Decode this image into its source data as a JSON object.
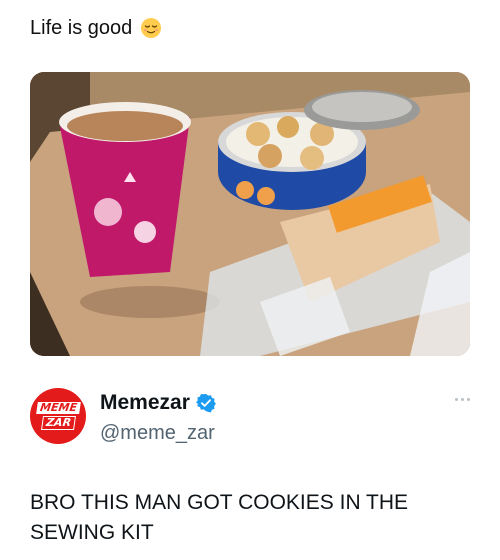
{
  "caption": {
    "text": "Life is good",
    "emoji": "relieved-face-emoji"
  },
  "photo": {
    "alt_subject": "photo"
  },
  "author": {
    "name": "Memezar",
    "handle": "@meme_zar",
    "verified": true,
    "avatar": {
      "line1": "MEME",
      "line2": "ZAR",
      "color": "#e31b1b"
    }
  },
  "post": {
    "text": "BRO THIS MAN GOT COOKIES IN THE SEWING KIT"
  },
  "colors": {
    "verified_blue": "#1d9bf0",
    "handle_gray": "#536471"
  }
}
